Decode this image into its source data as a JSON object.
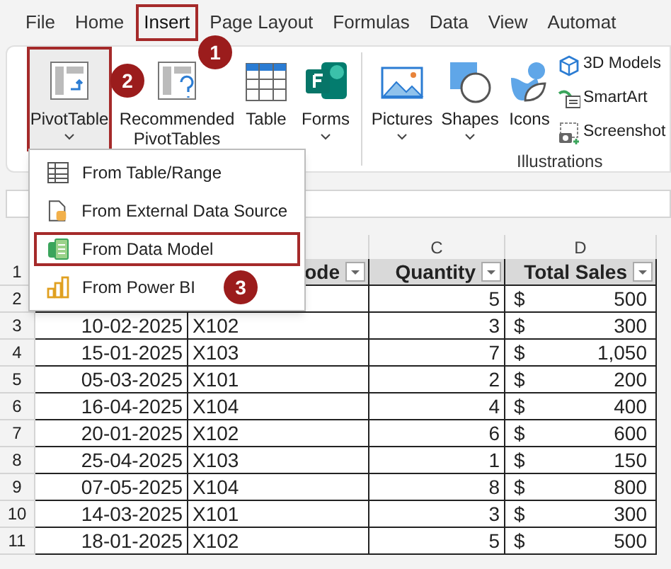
{
  "tabs": [
    {
      "label": "File",
      "selected": false,
      "highlighted": false
    },
    {
      "label": "Home",
      "selected": false,
      "highlighted": false
    },
    {
      "label": "Insert",
      "selected": true,
      "highlighted": true
    },
    {
      "label": "Page Layout",
      "selected": false,
      "highlighted": false
    },
    {
      "label": "Formulas",
      "selected": false,
      "highlighted": false
    },
    {
      "label": "Data",
      "selected": false,
      "highlighted": false
    },
    {
      "label": "View",
      "selected": false,
      "highlighted": false
    },
    {
      "label": "Automat",
      "selected": false,
      "highlighted": false
    }
  ],
  "ribbon": {
    "large_buttons": [
      {
        "kind": "pivot",
        "label": "PivotTable",
        "dropdown": true,
        "highlighted": true
      },
      {
        "kind": "recommended",
        "label": "Recommended PivotTables",
        "dropdown": false,
        "highlighted": false
      },
      {
        "kind": "table",
        "label": "Table",
        "dropdown": false,
        "highlighted": false
      },
      {
        "kind": "forms",
        "label": "Forms",
        "dropdown": true,
        "highlighted": false
      },
      {
        "kind": "pictures",
        "label": "Pictures",
        "dropdown": true,
        "highlighted": false
      },
      {
        "kind": "shapes",
        "label": "Shapes",
        "dropdown": true,
        "highlighted": false
      },
      {
        "kind": "icons",
        "label": "Icons",
        "dropdown": false,
        "highlighted": false
      }
    ],
    "small_buttons": [
      {
        "kind": "models",
        "label": "3D Models"
      },
      {
        "kind": "smartart",
        "label": "SmartArt"
      },
      {
        "kind": "screenshot",
        "label": "Screenshot"
      }
    ],
    "group_label": "Illustrations"
  },
  "dropdown_menu": [
    {
      "kind": "table",
      "label": "From Table/Range",
      "highlighted": false
    },
    {
      "kind": "external",
      "label": "From External Data Source",
      "highlighted": false
    },
    {
      "kind": "model",
      "label": "From Data Model",
      "highlighted": true
    },
    {
      "kind": "powerbi",
      "label": "From Power BI",
      "highlighted": false
    }
  ],
  "callouts": [
    "1",
    "2",
    "3"
  ],
  "sheet": {
    "columns": [
      "C",
      "D"
    ],
    "header": {
      "number": "1",
      "code": "ode",
      "quantity": "Quantity",
      "total": "Total Sales"
    },
    "rows": [
      {
        "number": "2",
        "quantity": "5",
        "currency": "$",
        "total": "500"
      },
      {
        "number": "3",
        "date": "10-02-2025",
        "code": "X102",
        "quantity": "3",
        "currency": "$",
        "total": "300"
      },
      {
        "number": "4",
        "date": "15-01-2025",
        "code": "X103",
        "quantity": "7",
        "currency": "$",
        "total": "1,050"
      },
      {
        "number": "5",
        "date": "05-03-2025",
        "code": "X101",
        "quantity": "2",
        "currency": "$",
        "total": "200"
      },
      {
        "number": "6",
        "date": "16-04-2025",
        "code": "X104",
        "quantity": "4",
        "currency": "$",
        "total": "400"
      },
      {
        "number": "7",
        "date": "20-01-2025",
        "code": "X102",
        "quantity": "6",
        "currency": "$",
        "total": "600"
      },
      {
        "number": "8",
        "date": "25-04-2025",
        "code": "X103",
        "quantity": "1",
        "currency": "$",
        "total": "150"
      },
      {
        "number": "9",
        "date": "07-05-2025",
        "code": "X104",
        "quantity": "8",
        "currency": "$",
        "total": "800"
      },
      {
        "number": "10",
        "date": "14-03-2025",
        "code": "X101",
        "quantity": "3",
        "currency": "$",
        "total": "300"
      },
      {
        "number": "11",
        "date": "18-01-2025",
        "code": "X102",
        "quantity": "5",
        "currency": "$",
        "total": "500"
      }
    ]
  }
}
